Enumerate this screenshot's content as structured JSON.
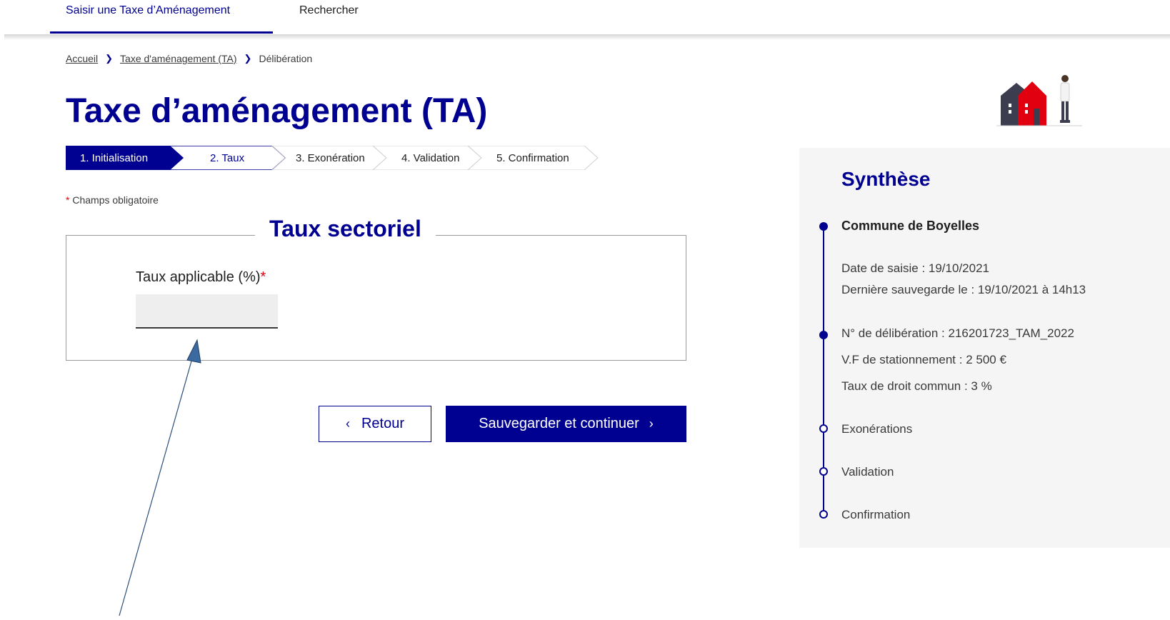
{
  "nav": {
    "items": [
      {
        "label": "Saisir une Taxe d’Aménagement",
        "active": true
      },
      {
        "label": "Rechercher",
        "active": false
      }
    ]
  },
  "breadcrumb": {
    "items": [
      "Accueil",
      "Taxe d'aménagement (TA)",
      "Délibération"
    ]
  },
  "page": {
    "title": "Taxe d’aménagement (TA)"
  },
  "stepper": {
    "steps": [
      "1. Initialisation",
      "2. Taux",
      "3. Exonération",
      "4. Validation",
      "5. Confirmation"
    ],
    "current_index": 1
  },
  "form": {
    "required_star": "*",
    "required_note": "Champs obligatoire",
    "legend": "Taux sectoriel",
    "rate_label": "Taux applicable (%)",
    "rate_value": ""
  },
  "buttons": {
    "back_label": "Retour",
    "save_label": "Sauvegarder et continuer"
  },
  "synthese": {
    "title": "Synthèse",
    "commune": "Commune de Boyelles",
    "date_saisie": "Date de saisie : 19/10/2021",
    "derniere_sauvegarde": "Dernière sauvegarde le : 19/10/2021 à 14h13",
    "deliberation": "N° de délibération : 216201723_TAM_2022",
    "vf_stationnement": "V.F de stationnement : 2 500 €",
    "taux_droit_commun": "Taux de droit commun : 3 %",
    "steps": [
      "Exonérations",
      "Validation",
      "Confirmation"
    ]
  },
  "colors": {
    "primary": "#000091",
    "required": "#e1000f",
    "panel_bg": "#f5f5f5",
    "arrow": "#3b6aa0"
  },
  "icons": [
    "chevron-right-icon",
    "chevron-left-icon",
    "house-illustration",
    "person-illustration"
  ]
}
